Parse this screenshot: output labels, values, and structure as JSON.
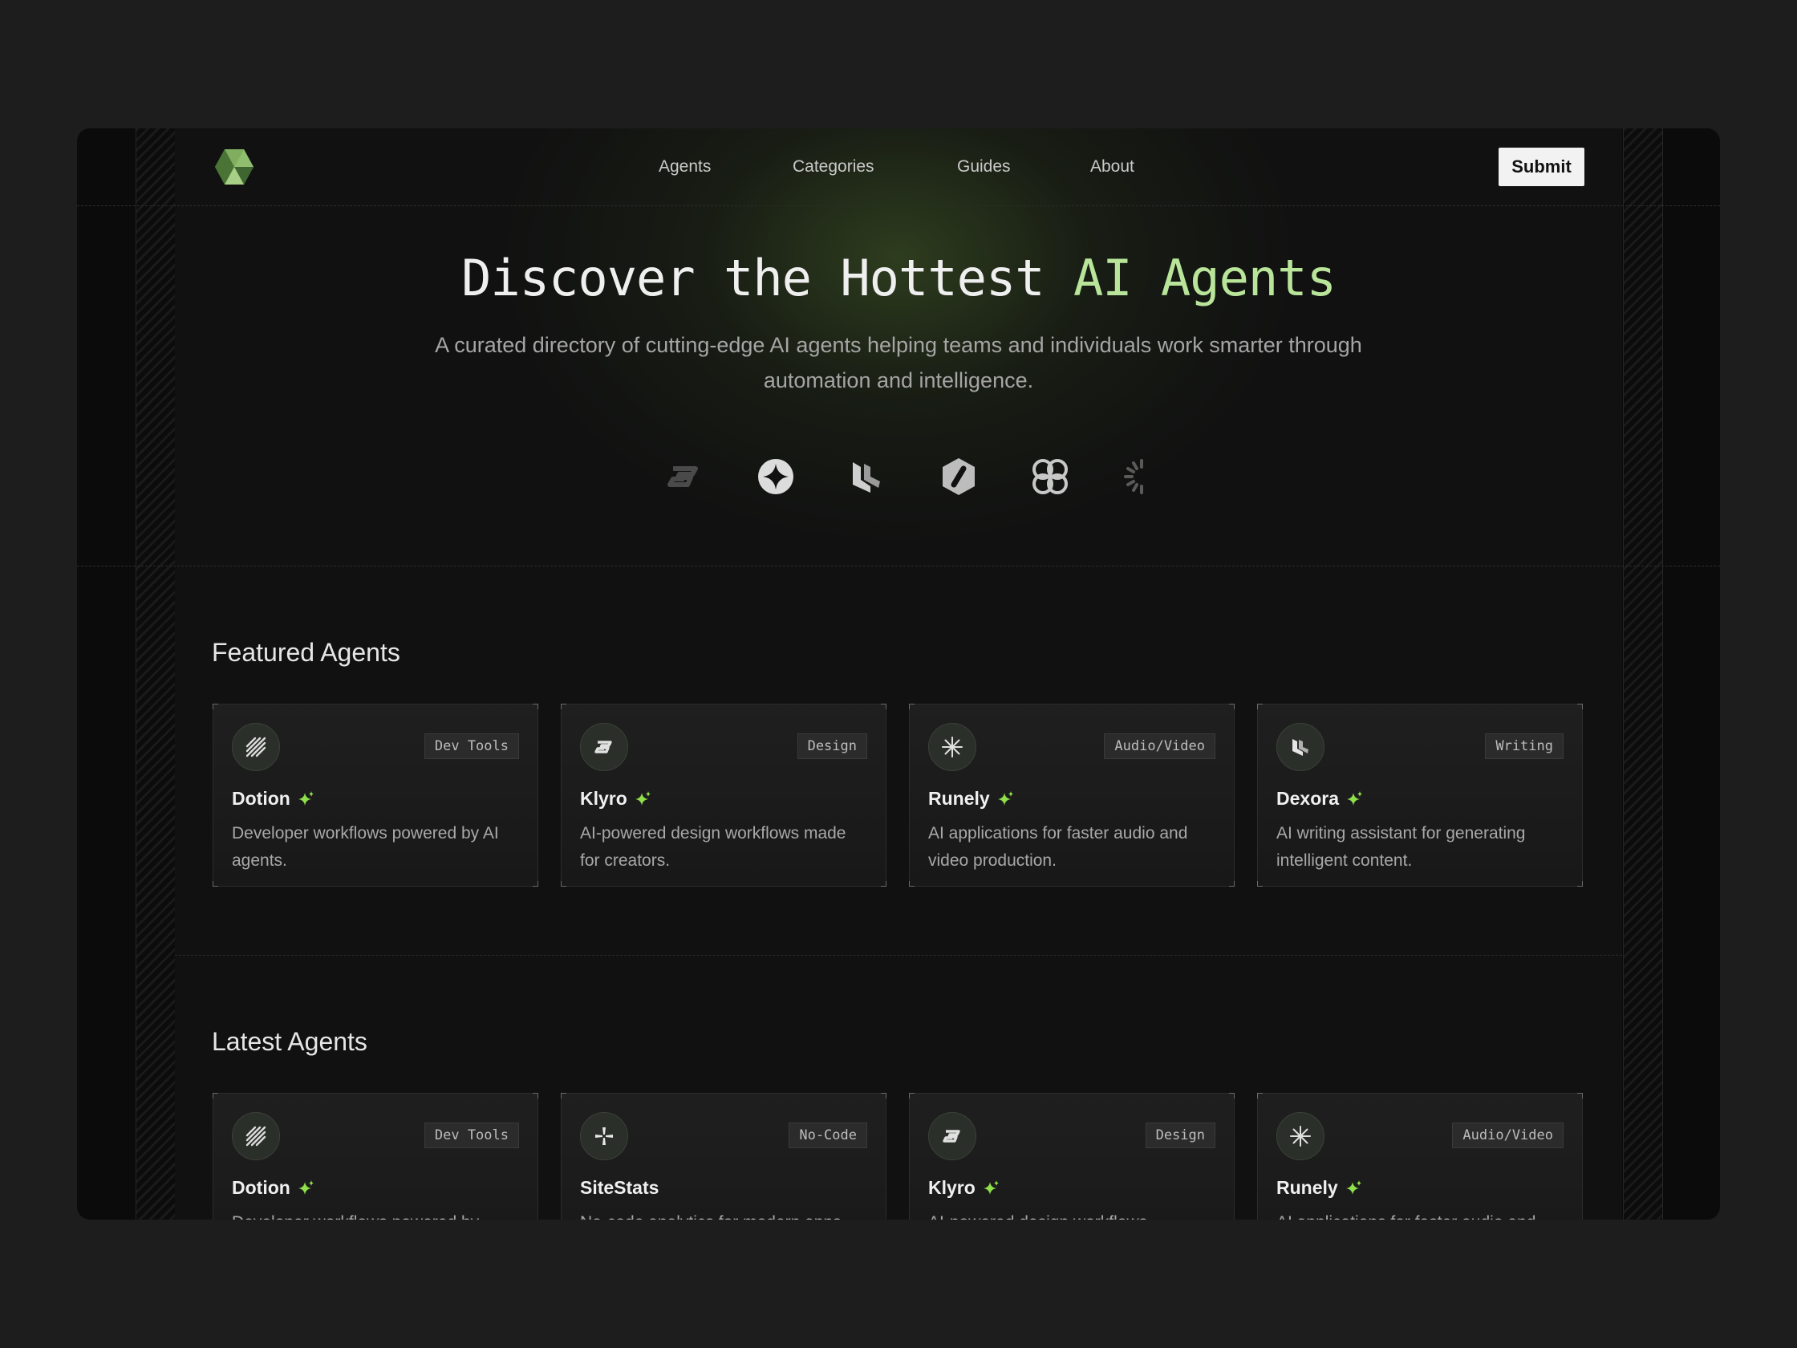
{
  "nav": {
    "items": [
      {
        "label": "Agents"
      },
      {
        "label": "Categories"
      },
      {
        "label": "Guides"
      },
      {
        "label": "About"
      }
    ],
    "submit_label": "Submit"
  },
  "hero": {
    "title_main": "Discover the Hottest ",
    "title_accent": "AI Agents",
    "subtitle": "A curated directory of cutting-edge AI agents helping teams and individuals work smarter through automation and intelligence."
  },
  "brand_icons": [
    "klyro-s-icon",
    "four-point-star-icon",
    "dexora-l-icon",
    "hexagon-slash-icon",
    "clover-ring-icon",
    "spinner-icon"
  ],
  "featured": {
    "title": "Featured Agents",
    "cards": [
      {
        "name": "Dotion",
        "tag": "Dev Tools",
        "icon": "stripes-icon",
        "description": "Developer workflows powered by AI agents."
      },
      {
        "name": "Klyro",
        "tag": "Design",
        "icon": "klyro-s-icon",
        "description": "AI-powered design workflows made for creators."
      },
      {
        "name": "Runely",
        "tag": "Audio/Video",
        "icon": "asterisk-icon",
        "description": "AI applications for faster audio and video production."
      },
      {
        "name": "Dexora",
        "tag": "Writing",
        "icon": "dexora-l-icon",
        "description": "AI writing assistant for generating intelligent content."
      }
    ]
  },
  "latest": {
    "title": "Latest Agents",
    "cards": [
      {
        "name": "Dotion",
        "tag": "Dev Tools",
        "icon": "stripes-icon",
        "description": "Developer workflows powered by"
      },
      {
        "name": "SiteStats",
        "tag": "No-Code",
        "icon": "pinwheel-icon",
        "description": "No-code analytics for modern apps"
      },
      {
        "name": "Klyro",
        "tag": "Design",
        "icon": "klyro-s-icon",
        "description": "AI-powered design workflows"
      },
      {
        "name": "Runely",
        "tag": "Audio/Video",
        "icon": "asterisk-icon",
        "description": "AI applications for faster audio and"
      }
    ]
  },
  "colors": {
    "accent": "#b9e59a",
    "spark": "#8fe04a",
    "background": "#111111"
  }
}
